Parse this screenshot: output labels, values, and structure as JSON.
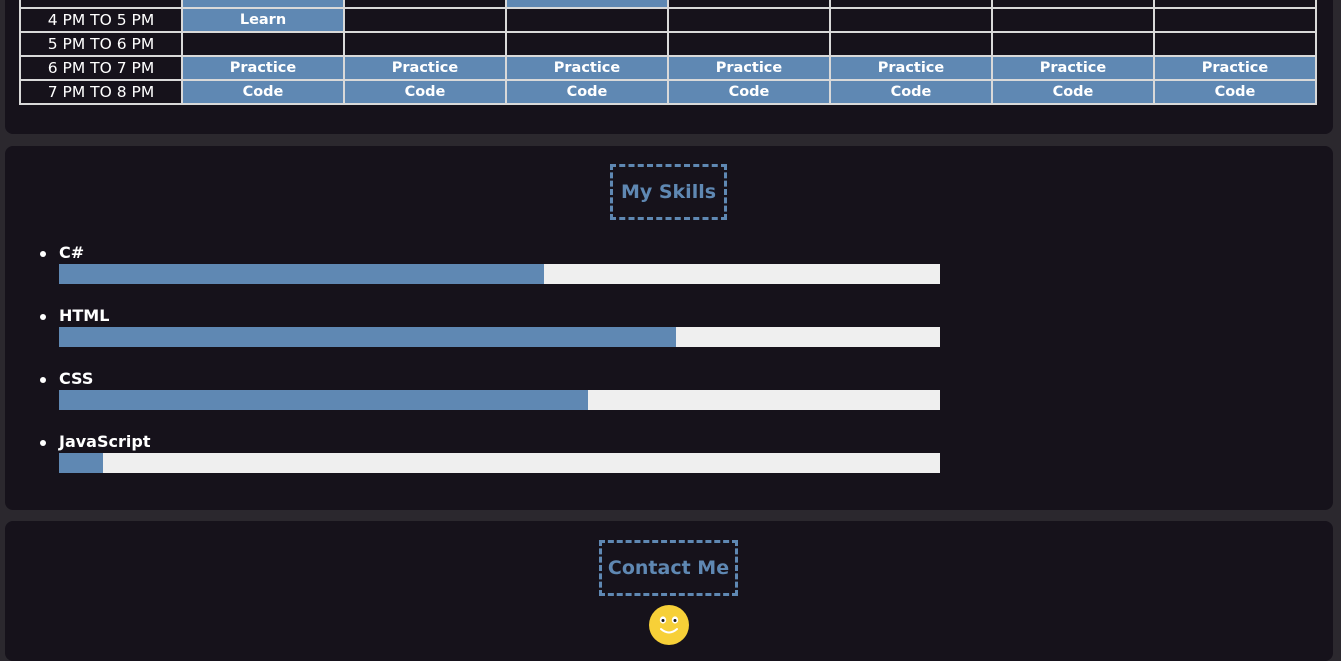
{
  "schedule": {
    "rows": [
      {
        "time": "",
        "slots": [
          "",
          "",
          "",
          "",
          "",
          "",
          ""
        ]
      },
      {
        "time": "4 PM TO 5 PM",
        "slots": [
          "Learn",
          "",
          "",
          "",
          "",
          "",
          ""
        ]
      },
      {
        "time": "5 PM TO 6 PM",
        "slots": [
          "",
          "",
          "",
          "",
          "",
          "",
          ""
        ]
      },
      {
        "time": "6 PM TO 7 PM",
        "slots": [
          "Practice",
          "Practice",
          "Practice",
          "Practice",
          "Practice",
          "Practice",
          "Practice"
        ]
      },
      {
        "time": "7 PM TO 8 PM",
        "slots": [
          "Code",
          "Code",
          "Code",
          "Code",
          "Code",
          "Code",
          "Code"
        ]
      }
    ]
  },
  "skills": {
    "title": "My Skills",
    "items": [
      {
        "name": "C#",
        "level_percent": 55
      },
      {
        "name": "HTML",
        "level_percent": 70
      },
      {
        "name": "CSS",
        "level_percent": 60
      },
      {
        "name": "JavaScript",
        "level_percent": 5
      }
    ]
  },
  "contact": {
    "title": "Contact Me",
    "icon": "smiley-face-icon"
  },
  "colors": {
    "accent": "#5f88b3",
    "panel_bg": "#16121b",
    "page_bg": "#2b282e",
    "bar_track": "#efefef",
    "smiley": "#f7d038"
  }
}
